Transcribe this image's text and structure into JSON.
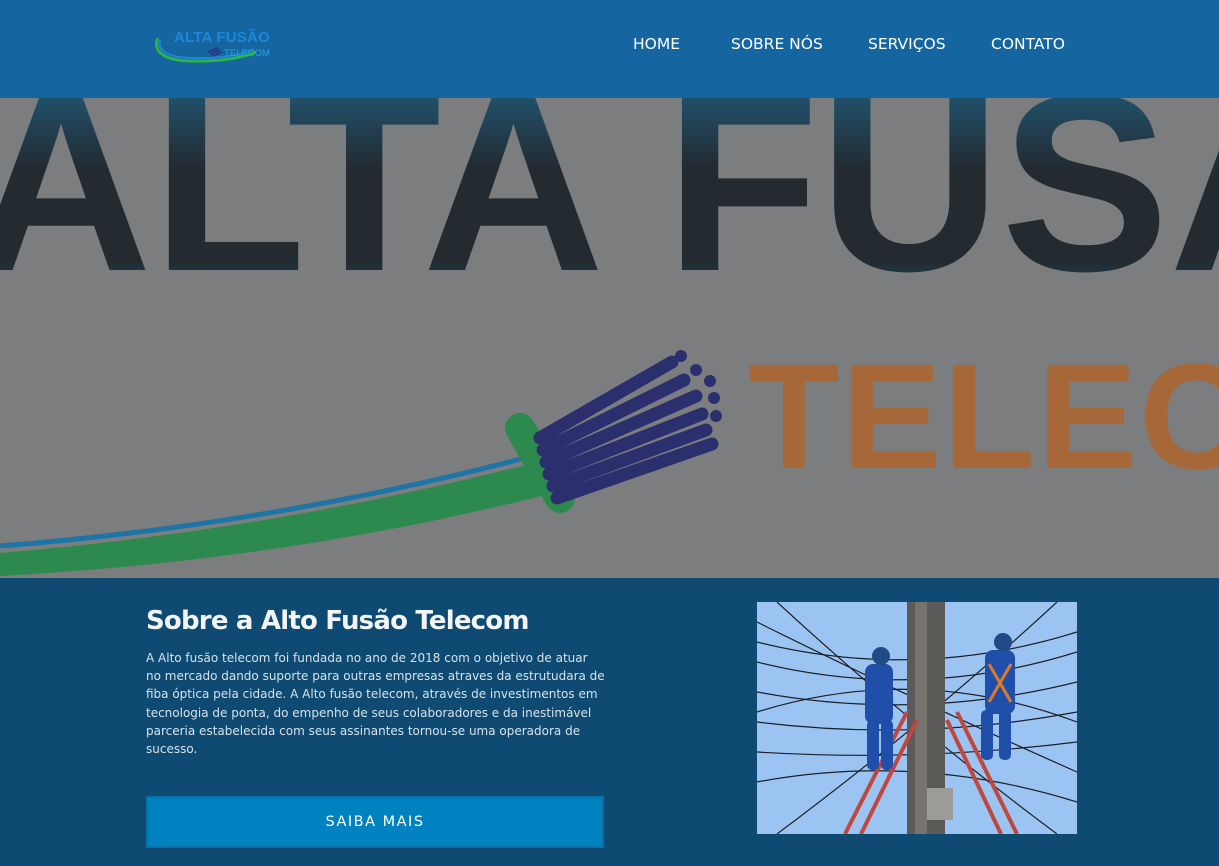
{
  "header": {
    "logo": {
      "title": "ALTA FUSÃO",
      "subtitle": "TELECOM"
    },
    "nav": [
      {
        "label": "HOME"
      },
      {
        "label": "SOBRE NÓS"
      },
      {
        "label": "SERVIÇOS"
      },
      {
        "label": "CONTATO"
      }
    ]
  },
  "hero": {
    "banner_word_1": "ALTA FUSÃO",
    "banner_word_2": "TELECOM",
    "slides_total": 3,
    "active_slide": 1
  },
  "about": {
    "title": "Sobre a Alto Fusão Telecom",
    "text": "A Alto fusão telecom foi fundada no ano de 2018 com o objetivo de atuar no mercado dando suporte para outras empresas atraves da estrutudara de fiba óptica pela cidade. A Alto fusão telecom, através de investimentos em tecnologia de ponta, do empenho de seus colaboradores e da inestimável parceria estabelecida com seus assinantes tornou-se uma operadora de sucesso.",
    "button_label": "SAIBA MAIS"
  },
  "colors": {
    "header_bg": "#1565a0",
    "about_bg": "#0e4a72",
    "button_bg": "#0082c0",
    "hero_overlay": "#7c7d7f"
  }
}
